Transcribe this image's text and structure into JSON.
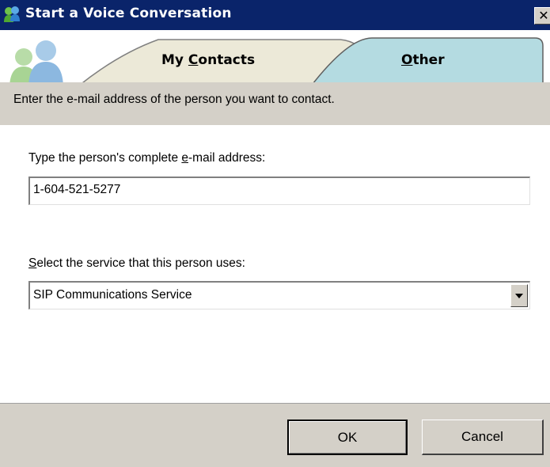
{
  "window": {
    "title": "Start a Voice Conversation",
    "title_icon": "messenger-buddies-icon",
    "close_label": "✕"
  },
  "tabs": [
    {
      "label": "My Contacts",
      "accesskey": "C",
      "selected": false
    },
    {
      "label": "Other",
      "accesskey": "O",
      "selected": true
    }
  ],
  "instructions": "Enter the e-mail address of the person you want to contact.",
  "email": {
    "label": "Type the person's complete e-mail address:",
    "accesskey": "e",
    "value": "1-604-521-5277"
  },
  "service": {
    "label": "Select the service that this person uses:",
    "accesskey": "S",
    "selected": "SIP Communications Service"
  },
  "buttons": {
    "ok": "OK",
    "cancel": "Cancel"
  },
  "colors": {
    "titlebar": "#0a246a",
    "dialog_face": "#d4d0c8",
    "tab_selected": "#b4dbe1",
    "tab_unselected": "#ece9d8"
  }
}
